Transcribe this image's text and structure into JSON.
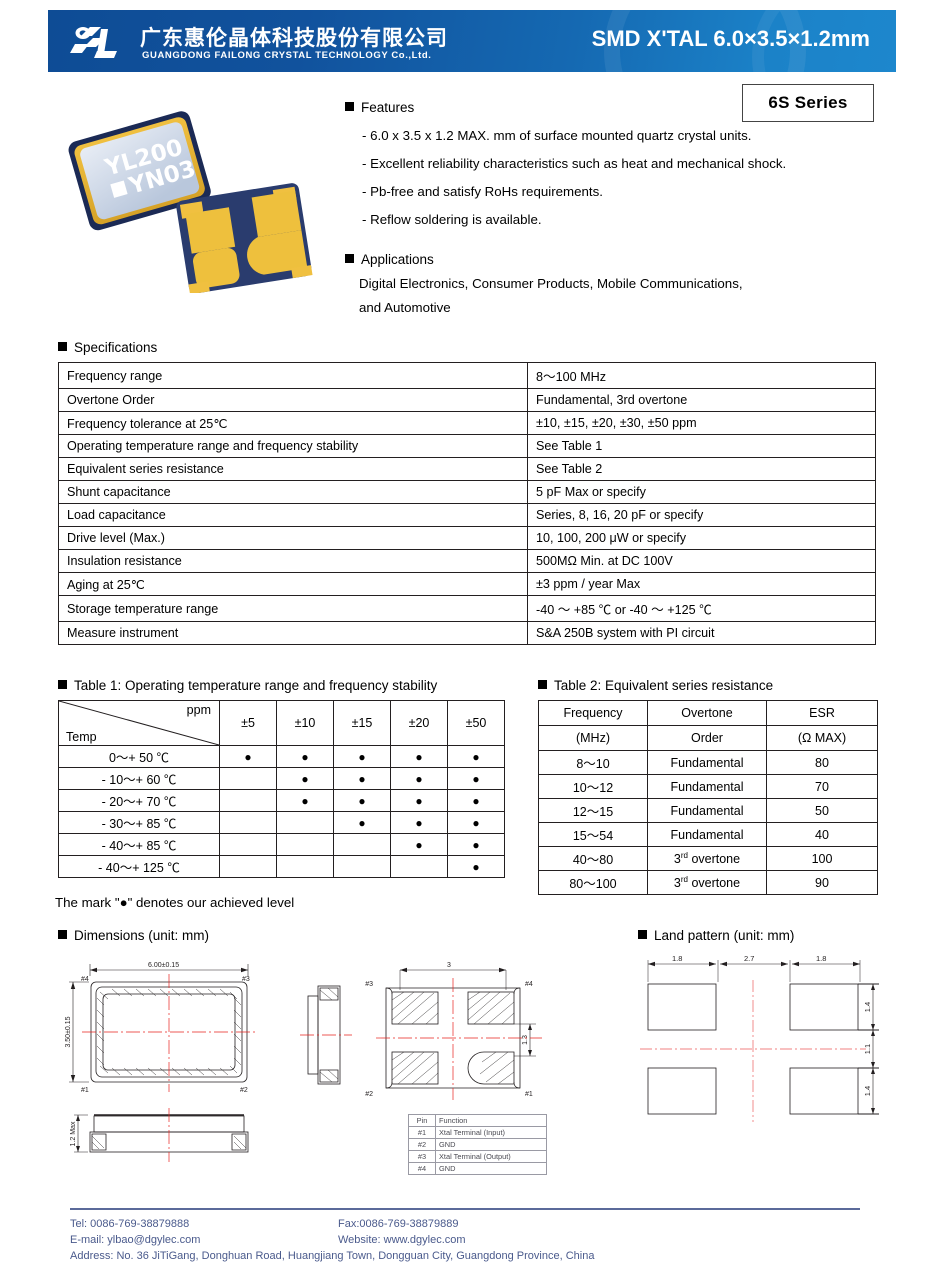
{
  "header": {
    "company_cn": "广东惠伦晶体科技股份有限公司",
    "company_en": "GUANGDONG FAILONG CRYSTAL TECHNOLOGY Co.,Ltd.",
    "product_title": "SMD X'TAL 6.0×3.5×1.2mm",
    "brand_blue_dark": "#0e4c95",
    "brand_blue_light": "#1d87cd"
  },
  "series_badge": "6S Series",
  "product_photo": {
    "marking_line1": "YL200",
    "marking_line2": "YN03"
  },
  "features": {
    "title": "Features",
    "items": [
      "- 6.0 x 3.5 x 1.2 MAX. mm of surface mounted quartz crystal units.",
      "- Excellent reliability characteristics such as heat and mechanical shock.",
      "- Pb-free and satisfy RoHs requirements.",
      "- Reflow soldering is available."
    ]
  },
  "applications": {
    "title": "Applications",
    "lines": [
      "Digital Electronics, Consumer Products, Mobile Communications,",
      "and Automotive"
    ]
  },
  "specifications": {
    "title": "Specifications",
    "rows": [
      {
        "parameter": "Frequency range",
        "value": "8～100 MHz"
      },
      {
        "parameter": "Overtone Order",
        "value": "Fundamental, 3rd overtone"
      },
      {
        "parameter": "Frequency tolerance at 25℃",
        "value": "±10, ±15, ±20, ±30, ±50 ppm"
      },
      {
        "parameter": "Operating temperature range and frequency stability",
        "value": "See Table 1"
      },
      {
        "parameter": "Equivalent series resistance",
        "value": "See Table 2"
      },
      {
        "parameter": "Shunt capacitance",
        "value": "5 pF Max or specify"
      },
      {
        "parameter": "Load capacitance",
        "value": "Series, 8, 16, 20 pF or specify"
      },
      {
        "parameter": "Drive level (Max.)",
        "value": "10, 100, 200 μW or specify"
      },
      {
        "parameter": "Insulation resistance",
        "value": "500MΩ Min. at DC 100V"
      },
      {
        "parameter": "Aging at 25℃",
        "value": "±3 ppm / year Max"
      },
      {
        "parameter": "Storage temperature range",
        "value": "-40 ～ +85 ℃ or -40 ～ +125 ℃"
      },
      {
        "parameter": "Measure instrument",
        "value": "S&A 250B system with PI circuit"
      }
    ]
  },
  "table1": {
    "title": "Table 1: Operating temperature range and frequency stability",
    "corner_top": "ppm",
    "corner_bottom": "Temp",
    "columns": [
      "±5",
      "±10",
      "±15",
      "±20",
      "±50"
    ],
    "dot_glyph": "●",
    "rows": [
      {
        "temp": "0～+ 50 ℃",
        "marks": [
          true,
          true,
          true,
          true,
          true
        ]
      },
      {
        "temp": "- 10～+ 60 ℃",
        "marks": [
          false,
          true,
          true,
          true,
          true
        ]
      },
      {
        "temp": "- 20～+ 70 ℃",
        "marks": [
          false,
          true,
          true,
          true,
          true
        ]
      },
      {
        "temp": "- 30～+ 85 ℃",
        "marks": [
          false,
          false,
          true,
          true,
          true
        ]
      },
      {
        "temp": "- 40～+ 85 ℃",
        "marks": [
          false,
          false,
          false,
          true,
          true
        ]
      },
      {
        "temp": "- 40～+ 125 ℃",
        "marks": [
          false,
          false,
          false,
          false,
          true
        ]
      }
    ]
  },
  "table2": {
    "title": "Table 2: Equivalent series resistance",
    "headers_line1": [
      "Frequency",
      "Overtone",
      "ESR"
    ],
    "headers_line2": [
      "(MHz)",
      "Order",
      "(Ω MAX)"
    ],
    "rows": [
      {
        "frequency": "8～10",
        "overtone": "Fundamental",
        "overtone_sup": "",
        "esr": "80"
      },
      {
        "frequency": "10～12",
        "overtone": "Fundamental",
        "overtone_sup": "",
        "esr": "70"
      },
      {
        "frequency": "12～15",
        "overtone": "Fundamental",
        "overtone_sup": "",
        "esr": "50"
      },
      {
        "frequency": "15～54",
        "overtone": "Fundamental",
        "overtone_sup": "",
        "esr": "40"
      },
      {
        "frequency": "40～80",
        "overtone": " overtone",
        "overtone_sup": "3rd",
        "esr": "100"
      },
      {
        "frequency": "80～100",
        "overtone": " overtone",
        "overtone_sup": "3rd",
        "esr": "90"
      }
    ]
  },
  "mark_note": "The mark \"●\" denotes our achieved level",
  "dimensions": {
    "title": "Dimensions (unit: mm)",
    "width": "6.00±0.15",
    "height": "3.50±0.15",
    "thickness": "1.2 Max",
    "pad_pitch": "3",
    "pad_span": "1.3",
    "pin_labels": [
      "#1",
      "#2",
      "#3",
      "#4"
    ]
  },
  "land_pattern": {
    "title": "Land pattern (unit: mm)",
    "h_dims": [
      "1.8",
      "2.7",
      "1.8"
    ],
    "v_dims": [
      "1.4",
      "1.1",
      "1.4"
    ]
  },
  "pin_table": {
    "headers": [
      "Pin",
      "Function"
    ],
    "rows": [
      {
        "pin": "#1",
        "function": "Xtal Terminal (Input)"
      },
      {
        "pin": "#2",
        "function": "GND"
      },
      {
        "pin": "#3",
        "function": "Xtal Terminal (Output)"
      },
      {
        "pin": "#4",
        "function": "GND"
      }
    ]
  },
  "footer": {
    "tel": "Tel: 0086-769-38879888",
    "fax": "Fax:0086-769-38879889",
    "email": "E-mail: ylbao@dgylec.com",
    "website": "Website: www.dgylec.com",
    "address": "Address: No. 36 JiTiGang, Donghuan Road, Huangjiang Town, Dongguan City, Guangdong Province, China"
  }
}
